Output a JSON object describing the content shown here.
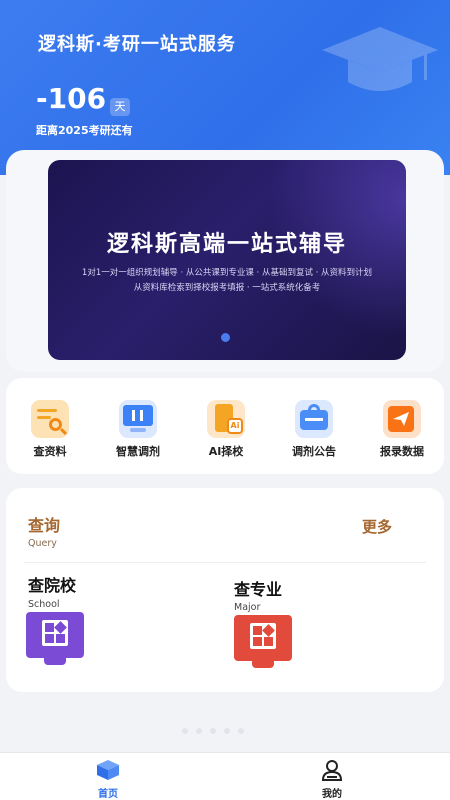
{
  "header": {
    "title": "逻科斯·考研一站式服务",
    "countdown_value": "-106",
    "countdown_unit": "天",
    "countdown_label": "距离2025考研还有"
  },
  "banner": {
    "title": "逻科斯高端一站式辅导",
    "subtitle_line1": "1对1一对一组织规划辅导 · 从公共课到专业课 · 从基础到复试 · 从资料到计划",
    "subtitle_line2": "从资料库检索到择校报考填报 · 一站式系统化备考",
    "active_slide": 1,
    "total_slides": 1
  },
  "quick_actions": [
    {
      "label": "查资料",
      "icon": "search-document-icon",
      "color": "#f5a524"
    },
    {
      "label": "智慧调剂",
      "icon": "monitor-transfer-icon",
      "color": "#3b82f6"
    },
    {
      "label": "AI择校",
      "icon": "ai-school-building-icon",
      "color": "#f59e0b"
    },
    {
      "label": "调剂公告",
      "icon": "announcement-icon",
      "color": "#3b82f6"
    },
    {
      "label": "报录数据",
      "icon": "paper-plane-data-icon",
      "color": "#f97316"
    }
  ],
  "query": {
    "title": "查询",
    "subtitle": "Query",
    "more": "更多",
    "cards": [
      {
        "title": "查院校",
        "subtitle": "School",
        "icon": "school-grid-icon",
        "color": "#7b4bd6"
      },
      {
        "title": "查专业",
        "subtitle": "Major",
        "icon": "major-grid-icon",
        "color": "#e24a3b"
      }
    ]
  },
  "page_indicator": {
    "count": 5
  },
  "tabbar": {
    "home_label": "首页",
    "mine_label": "我的",
    "active": "首页"
  },
  "colors": {
    "primary": "#2f6fe9",
    "accent_brown": "#a5672f"
  }
}
